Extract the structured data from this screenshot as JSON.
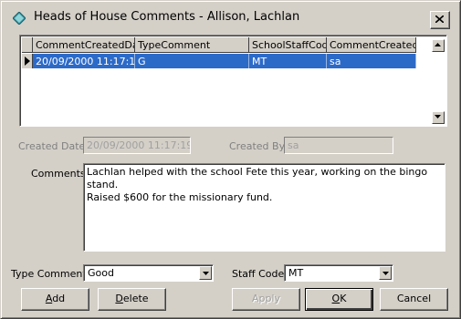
{
  "window": {
    "title": "Heads of House Comments - Allison, Lachlan"
  },
  "grid": {
    "columns": [
      "CommentCreatedDate",
      "TypeComment",
      "SchoolStaffCode",
      "CommentCreatedBy"
    ],
    "rows": [
      {
        "date": "20/09/2000 11:17:19",
        "type": "G",
        "staff": "MT",
        "by": "sa"
      }
    ]
  },
  "created_date": {
    "label": "Created Date:",
    "value": "20/09/2000 11:17:19"
  },
  "created_by": {
    "label": "Created By:",
    "value": "sa"
  },
  "comments": {
    "label": "Comments:",
    "value": "Lachlan helped with the school Fete this year, working on the bingo stand.\nRaised $600 for the missionary fund."
  },
  "type_comment": {
    "label": "Type Comment:",
    "value": "Good"
  },
  "staff_code": {
    "label": "Staff Code:",
    "value": "MT"
  },
  "buttons": {
    "add_pre": "",
    "add_u": "A",
    "add_post": "dd",
    "delete_pre": "",
    "delete_u": "D",
    "delete_post": "elete",
    "apply": "Apply",
    "ok_pre": "",
    "ok_u": "O",
    "ok_post": "K",
    "cancel": "Cancel"
  },
  "icons": {
    "app": "diamond-app-icon",
    "close": "close-icon",
    "row": "row-pointer-icon",
    "scroll_up": "scroll-up-arrow-icon",
    "scroll_down": "scroll-down-arrow-icon",
    "dropdown": "dropdown-arrow-icon"
  },
  "colors": {
    "selection": "#2c6ac8",
    "face": "#d4d0c8"
  }
}
